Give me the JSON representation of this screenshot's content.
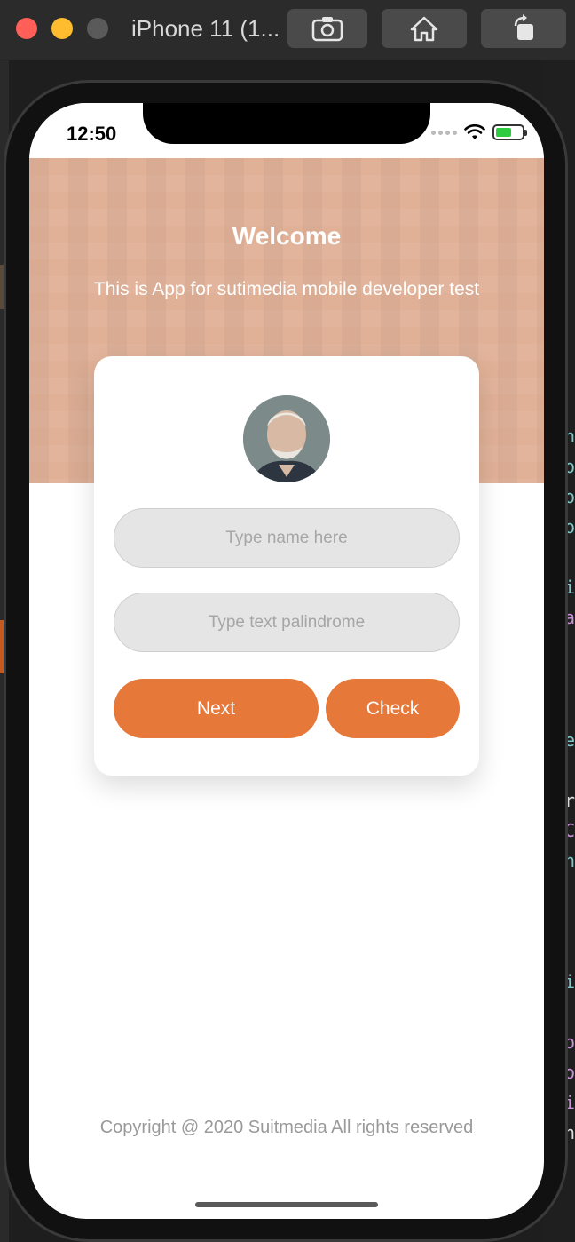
{
  "window": {
    "title": "iPhone 11 (1..."
  },
  "status_bar": {
    "time": "12:50"
  },
  "header": {
    "title": "Welcome",
    "subtitle": "This is App for sutimedia mobile developer test"
  },
  "form": {
    "name_placeholder": "Type name here",
    "palindrome_placeholder": "Type text palindrome",
    "next_label": "Next",
    "check_label": "Check"
  },
  "footer": {
    "copyright": "Copyright @ 2020 Suitmedia All rights reserved"
  },
  "colors": {
    "accent": "#e6793a",
    "header_bg": "#e1b197",
    "input_bg": "#e5e5e5",
    "placeholder": "#a6a6a6"
  },
  "icons": {
    "toolbar": [
      "screenshot-icon",
      "home-icon",
      "rotate-icon"
    ],
    "status": [
      "signal-icon",
      "wifi-icon",
      "battery-icon"
    ]
  }
}
